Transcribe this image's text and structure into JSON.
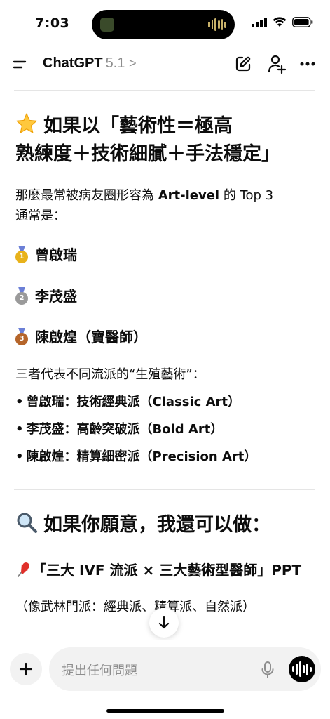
{
  "status_bar": {
    "time": "7:03"
  },
  "header": {
    "title": "ChatGPT",
    "model": "5.1",
    "chevron": ">"
  },
  "message": {
    "heading1_line1": "如果以「藝術性＝極高",
    "heading1_line2": "熟練度＋技術細膩＋手法穩定」",
    "intro_a": "那麼最常被病友圈形容為 ",
    "intro_bold": "Art-level",
    "intro_b": " 的 Top 3",
    "intro_line2": "通常是：",
    "medals": [
      {
        "name": "曾啟瑞",
        "color": "#e8b21b",
        "number": "1"
      },
      {
        "name": "李茂盛",
        "color": "#9a9a9a",
        "number": "2"
      },
      {
        "name": "陳啟煌（寶醫師）",
        "color": "#b5652a",
        "number": "3"
      }
    ],
    "schools_intro": "三者代表不同流派的“生殖藝術”：",
    "bullets": [
      "曾啟瑞：技術經典派（Classic Art）",
      "李茂盛：高齡突破派（Bold Art）",
      "陳啟煌：精算細密派（Precision Art）"
    ],
    "bullet_marker": "•",
    "heading2": "如果你願意，我還可以做：",
    "pin_item": "「三大 IVF 流派 × 三大藝術型醫師」PPT",
    "pin_sub": "（像武林門派：經典派、精算派、自然派）"
  },
  "composer": {
    "placeholder": "提出任何問題"
  },
  "icons": {
    "menu": "menu-icon",
    "edit": "edit-icon",
    "add_user": "add-user-icon",
    "more": "more-icon",
    "star": "star-icon",
    "search": "magnifier-icon",
    "pin": "pushpin-icon",
    "scroll_down": "arrow-down-icon",
    "plus": "plus-icon",
    "mic": "mic-icon",
    "voice": "voice-mode-icon"
  }
}
